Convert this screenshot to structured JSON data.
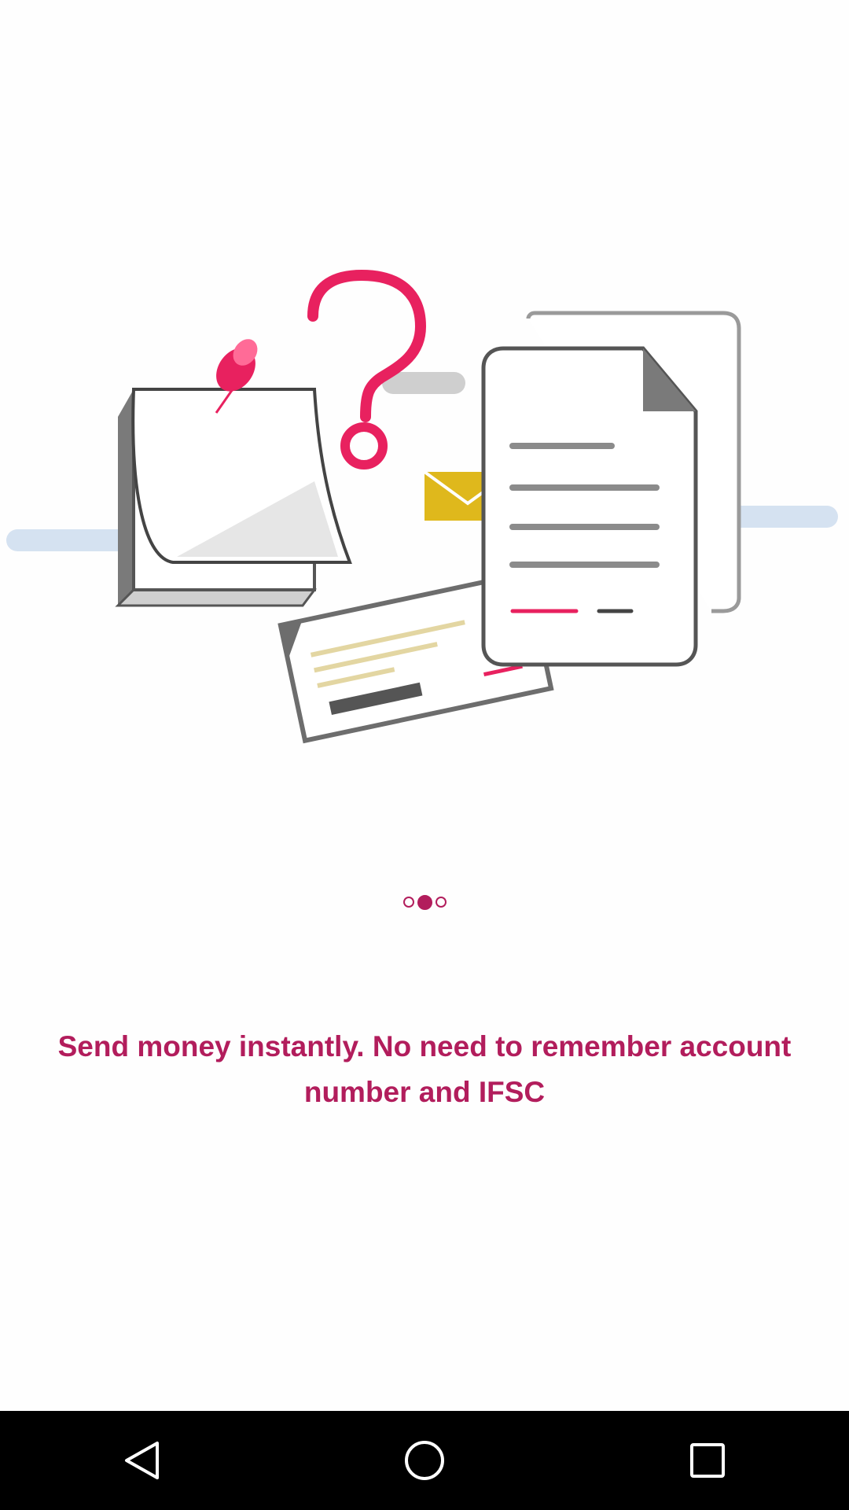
{
  "onboarding": {
    "headline": "Send money instantly. No need to remember account number and IFSC",
    "pager": {
      "total": 3,
      "active_index": 1
    },
    "colors": {
      "accent": "#b21d5c",
      "pink": "#e8215f",
      "mail_yellow": "#dfb81c",
      "line_blue": "#d5e2f1",
      "grey": "#6d6d6d"
    }
  },
  "navbar": {
    "back_icon": "back-triangle-icon",
    "home_icon": "home-circle-icon",
    "recents_icon": "recents-square-icon"
  }
}
